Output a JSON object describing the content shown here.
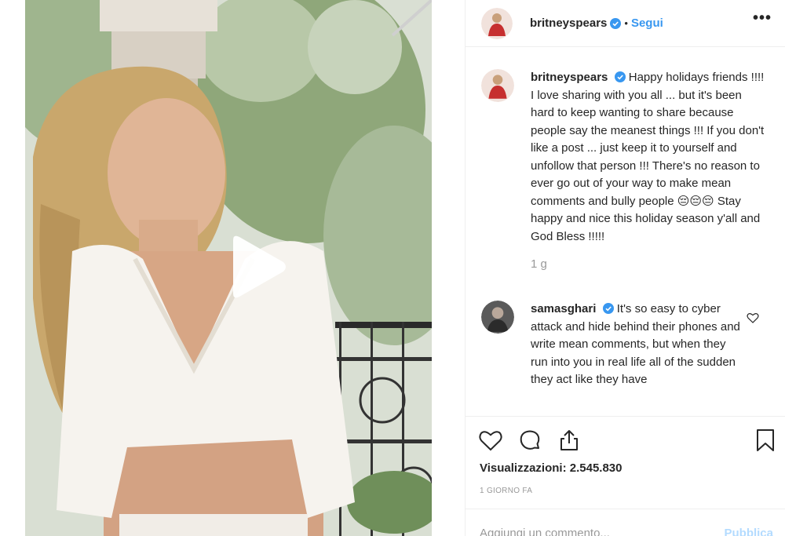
{
  "post": {
    "author": "britneyspears",
    "follow_label": "Segui",
    "separator": "•",
    "more_label": "•••"
  },
  "caption": {
    "username": "britneyspears",
    "text": "Happy holidays friends !!!! I love sharing with you all ... but it's been hard to keep wanting to share because people say the meanest things !!! If you don't like a post ... just keep it to yourself and unfollow that person !!! There's no reason to ever go out of your way to make mean comments and bully people 😔😔😔 Stay happy and nice this holiday season y'all and God Bless !!!!!",
    "time": "1 g"
  },
  "comment": {
    "username": "samasghari",
    "text": "It's so easy to cyber attack and hide behind their phones and write mean comments, but when they run into you in real life all of the sudden they act like they have"
  },
  "stats": {
    "views_label": "Visualizzazioni: 2.545.830",
    "date": "1 GIORNO FA"
  },
  "add_comment": {
    "placeholder": "Aggiungi un commento...",
    "publish_label": "Pubblica"
  },
  "icons": {
    "play": "play-icon",
    "like": "heart-icon",
    "comment": "comment-icon",
    "share": "share-icon",
    "save": "bookmark-icon",
    "verified": "verified-badge-icon"
  },
  "colors": {
    "link": "#3897f0",
    "verified": "#3897f0",
    "muted": "#999999",
    "text": "#262626",
    "border": "#efefef"
  }
}
